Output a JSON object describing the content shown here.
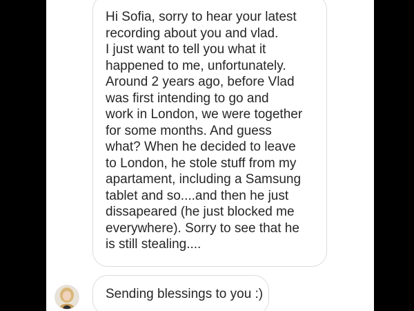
{
  "conversation": {
    "received_message": {
      "lines": [
        "Hi Sofia, sorry to hear your latest",
        "recording about you and vlad.",
        "I just want to tell you what it",
        "happened to me, unfortunately.",
        "Around 2 years ago, before Vlad",
        "was first intending to go and",
        "work in London, we were together",
        "for some months. And guess",
        "what? When he decided to leave",
        "to London, he stole stuff from my",
        "apartament, including a Samsung",
        "tablet and so....and then he just",
        "dissapeared (he just blocked me",
        "everywhere). Sorry to see that he",
        "is still stealing...."
      ]
    },
    "second_message": {
      "text": "Sending blessings to you :)"
    }
  },
  "colors": {
    "bubble_border": "#dcdcdc",
    "text": "#262626",
    "background": "#ffffff",
    "letterbox": "#000000"
  },
  "icons": {
    "sender_avatar": "profile-photo"
  }
}
